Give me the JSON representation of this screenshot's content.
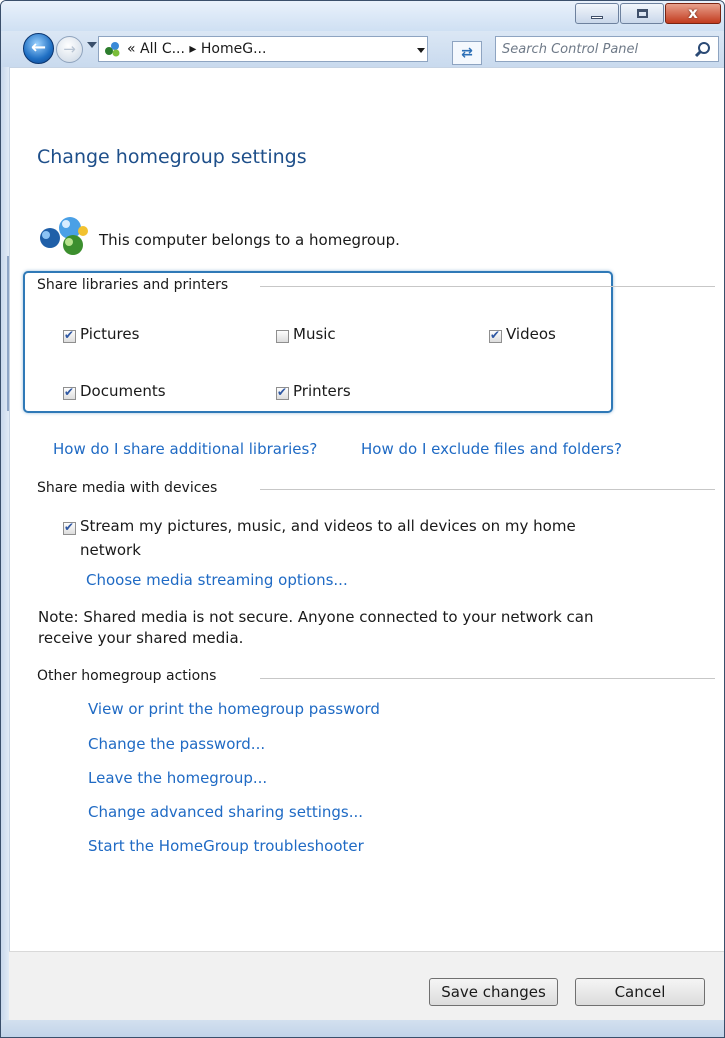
{
  "window": {
    "caption_buttons": {
      "close_glyph": "x"
    }
  },
  "navigation": {
    "breadcrumb_text": "«  All C...  ▸  HomeG...",
    "search_placeholder": "Search Control Panel"
  },
  "page": {
    "title": "Change homegroup settings",
    "belongs_text": "This computer belongs to a homegroup."
  },
  "share_libraries": {
    "header": "Share libraries and printers",
    "items": [
      {
        "label": "Pictures",
        "checked": true
      },
      {
        "label": "Music",
        "checked": false
      },
      {
        "label": "Videos",
        "checked": true
      },
      {
        "label": "Documents",
        "checked": true
      },
      {
        "label": "Printers",
        "checked": true
      }
    ]
  },
  "help_links": {
    "share_additional": "How do I share additional libraries?",
    "exclude_files": "How do I exclude files and folders?"
  },
  "share_media": {
    "header": "Share media with devices",
    "stream_label_line1": "Stream my pictures, music, and videos to all devices on my home",
    "stream_label_line2": "network",
    "stream_checked": true,
    "streaming_options_link": "Choose media streaming options...",
    "note_line1": "Note: Shared media is not secure. Anyone connected to your network can",
    "note_line2": "receive your shared media."
  },
  "other_actions": {
    "header": "Other homegroup actions",
    "links": [
      "View or print the homegroup password",
      "Change the password...",
      "Leave the homegroup...",
      "Change advanced sharing settings...",
      "Start the HomeGroup troubleshooter"
    ]
  },
  "footer": {
    "save_label": "Save changes",
    "cancel_label": "Cancel"
  },
  "colors": {
    "link": "#1f6ac4",
    "title": "#1e4f8a",
    "highlight_border": "#2f79b7"
  }
}
